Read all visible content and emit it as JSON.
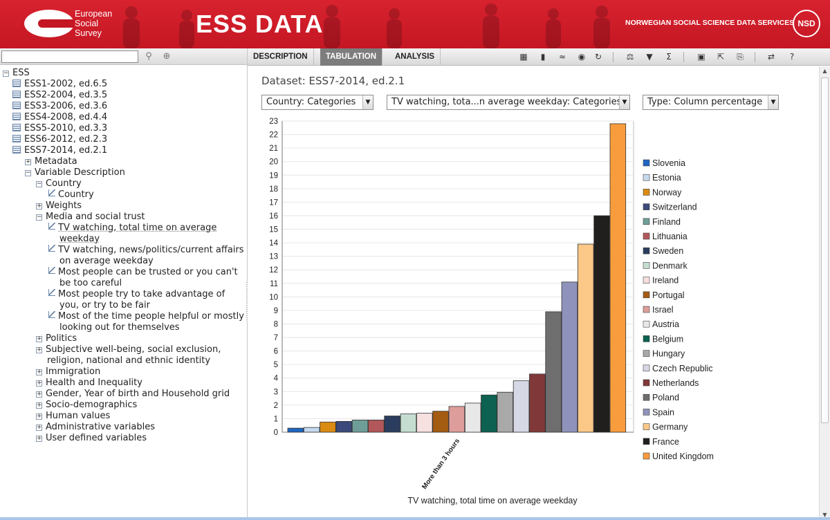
{
  "header": {
    "logo_text": [
      "European",
      "Social",
      "Survey"
    ],
    "app_title": "ESS DATA",
    "org_name": "NORWEGIAN SOCIAL SCIENCE DATA SERVICES",
    "org_logo": "NSD",
    "brand_color": "#c41723"
  },
  "search": {
    "value": "",
    "placeholder": ""
  },
  "tree": {
    "nodes": [
      {
        "label": "ESS",
        "level": 0,
        "kind": "root",
        "expanded": true
      },
      {
        "label": "ESS1-2002, ed.6.5",
        "level": 1,
        "kind": "table"
      },
      {
        "label": "ESS2-2004, ed.3.5",
        "level": 1,
        "kind": "table"
      },
      {
        "label": "ESS3-2006, ed.3.6",
        "level": 1,
        "kind": "table"
      },
      {
        "label": "ESS4-2008, ed.4.4",
        "level": 1,
        "kind": "table"
      },
      {
        "label": "ESS5-2010, ed.3.3",
        "level": 1,
        "kind": "table"
      },
      {
        "label": "ESS6-2012, ed.2.3",
        "level": 1,
        "kind": "table"
      },
      {
        "label": "ESS7-2014, ed.2.1",
        "level": 1,
        "kind": "table"
      },
      {
        "label": "Metadata",
        "level": 2,
        "kind": "folder",
        "expanded": false
      },
      {
        "label": "Variable Description",
        "level": 2,
        "kind": "folder",
        "expanded": true
      },
      {
        "label": "Country",
        "level": 3,
        "kind": "folder",
        "expanded": true
      },
      {
        "label": "Country",
        "level": 4,
        "kind": "variable"
      },
      {
        "label": "Weights",
        "level": 3,
        "kind": "folder",
        "expanded": false
      },
      {
        "label": "Media and social trust",
        "level": 3,
        "kind": "folder",
        "expanded": true
      },
      {
        "label": "TV watching, total time on average",
        "label2": "weekday",
        "level": 4,
        "kind": "variable",
        "selected": true
      },
      {
        "label": "TV watching, news/politics/current affairs",
        "label2": "on average weekday",
        "level": 4,
        "kind": "variable"
      },
      {
        "label": "Most people can be trusted or you can't",
        "label2": "be too careful",
        "level": 4,
        "kind": "variable"
      },
      {
        "label": "Most people try to take advantage of",
        "label2": "you, or try to be fair",
        "level": 4,
        "kind": "variable"
      },
      {
        "label": "Most of the time people helpful or mostly",
        "label2": "looking out for themselves",
        "level": 4,
        "kind": "variable"
      },
      {
        "label": "Politics",
        "level": 3,
        "kind": "folder",
        "expanded": false
      },
      {
        "label": "Subjective well-being, social exclusion,",
        "label2": "religion, national and ethnic identity",
        "level": 3,
        "kind": "folder",
        "expanded": false
      },
      {
        "label": "Immigration",
        "level": 3,
        "kind": "folder",
        "expanded": false
      },
      {
        "label": "Health and Inequality",
        "level": 3,
        "kind": "folder",
        "expanded": false
      },
      {
        "label": "Gender, Year of birth and Household grid",
        "level": 3,
        "kind": "folder",
        "expanded": false
      },
      {
        "label": "Socio-demographics",
        "level": 3,
        "kind": "folder",
        "expanded": false
      },
      {
        "label": "Human values",
        "level": 3,
        "kind": "folder",
        "expanded": false
      },
      {
        "label": "Administrative variables",
        "level": 3,
        "kind": "folder",
        "expanded": false
      },
      {
        "label": "User defined variables",
        "level": 3,
        "kind": "folder",
        "expanded": false
      }
    ]
  },
  "tabs": [
    {
      "label": "DESCRIPTION",
      "active": false
    },
    {
      "label": "TABULATION",
      "active": true
    },
    {
      "label": "ANALYSIS",
      "active": false
    }
  ],
  "toolbar_icons": [
    "table-view-icon",
    "bar-chart-icon",
    "line-chart-icon",
    "map-icon",
    "refresh-icon",
    "weight-icon",
    "filter-icon",
    "sigma-icon",
    "save-icon",
    "export-icon",
    "print-icon",
    "settings-icon",
    "help-icon"
  ],
  "dataset": {
    "label": "Dataset: ESS7-2014, ed.2.1"
  },
  "dropdowns": {
    "row": "Country: Categories",
    "column": "TV watching, tota...n average weekday: Categories",
    "type": "Type: Column percentage"
  },
  "chart_data": {
    "type": "bar",
    "categories": [
      "More than 3 hours"
    ],
    "xlabel": "TV watching, total time on average weekday",
    "ylabel": "",
    "ylim": [
      0,
      23
    ],
    "yticks": [
      0,
      1,
      2,
      3,
      4,
      5,
      6,
      7,
      8,
      9,
      10,
      11,
      12,
      13,
      14,
      15,
      16,
      17,
      18,
      19,
      20,
      21,
      22,
      23
    ],
    "grid": true,
    "legend_position": "right",
    "series": [
      {
        "name": "Slovenia",
        "values": [
          0.3
        ],
        "color": "#1f66c2"
      },
      {
        "name": "Estonia",
        "values": [
          0.35
        ],
        "color": "#c6d9ee"
      },
      {
        "name": "Norway",
        "values": [
          0.75
        ],
        "color": "#d98b12"
      },
      {
        "name": "Switzerland",
        "values": [
          0.8
        ],
        "color": "#3b4a7a"
      },
      {
        "name": "Finland",
        "values": [
          0.9
        ],
        "color": "#6f9e98"
      },
      {
        "name": "Lithuania",
        "values": [
          0.9
        ],
        "color": "#b2575a"
      },
      {
        "name": "Sweden",
        "values": [
          1.2
        ],
        "color": "#2b3d5e"
      },
      {
        "name": "Denmark",
        "values": [
          1.35
        ],
        "color": "#c5ddd1"
      },
      {
        "name": "Ireland",
        "values": [
          1.4
        ],
        "color": "#f6e0e0"
      },
      {
        "name": "Portugal",
        "values": [
          1.55
        ],
        "color": "#a45b12"
      },
      {
        "name": "Israel",
        "values": [
          1.9
        ],
        "color": "#dd9d9b"
      },
      {
        "name": "Austria",
        "values": [
          2.15
        ],
        "color": "#e8e8e8"
      },
      {
        "name": "Belgium",
        "values": [
          2.75
        ],
        "color": "#0c6150"
      },
      {
        "name": "Hungary",
        "values": [
          2.95
        ],
        "color": "#a9a9a9"
      },
      {
        "name": "Czech Republic",
        "values": [
          3.8
        ],
        "color": "#d7d8e6"
      },
      {
        "name": "Netherlands",
        "values": [
          4.3
        ],
        "color": "#813838"
      },
      {
        "name": "Poland",
        "values": [
          8.9
        ],
        "color": "#6e6e6e"
      },
      {
        "name": "Spain",
        "values": [
          11.1
        ],
        "color": "#8f93bb"
      },
      {
        "name": "Germany",
        "values": [
          13.9
        ],
        "color": "#fbc888"
      },
      {
        "name": "France",
        "values": [
          16.0
        ],
        "color": "#201f1e"
      },
      {
        "name": "United Kingdom",
        "values": [
          22.8
        ],
        "color": "#f89c3e"
      }
    ]
  }
}
